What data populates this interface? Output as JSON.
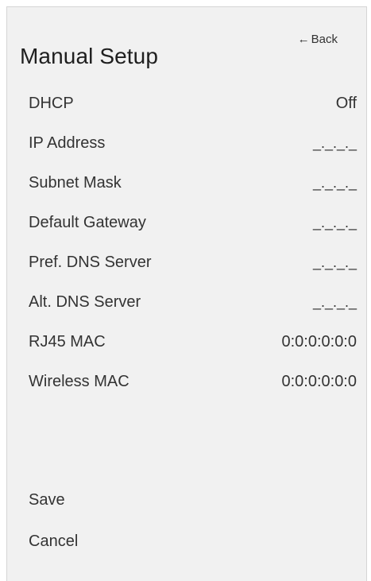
{
  "header": {
    "title": "Manual Setup",
    "back_label": "Back",
    "back_icon": "arrow-left-icon"
  },
  "settings": [
    {
      "key": "dhcp",
      "label": "DHCP",
      "value": "Off"
    },
    {
      "key": "ip-address",
      "label": "IP Address",
      "value": "_._._._"
    },
    {
      "key": "subnet-mask",
      "label": "Subnet Mask",
      "value": "_._._._"
    },
    {
      "key": "default-gateway",
      "label": "Default Gateway",
      "value": "_._._._"
    },
    {
      "key": "pref-dns-server",
      "label": "Pref. DNS Server",
      "value": "_._._._"
    },
    {
      "key": "alt-dns-server",
      "label": "Alt. DNS Server",
      "value": "_._._._"
    },
    {
      "key": "rj45-mac",
      "label": "RJ45 MAC",
      "value": "0:0:0:0:0:0"
    },
    {
      "key": "wireless-mac",
      "label": "Wireless MAC",
      "value": "0:0:0:0:0:0"
    }
  ],
  "actions": {
    "save_label": "Save",
    "cancel_label": "Cancel"
  },
  "colors": {
    "panel_background": "#f1f1f1",
    "page_background": "#ffffff",
    "text": "#333333"
  }
}
